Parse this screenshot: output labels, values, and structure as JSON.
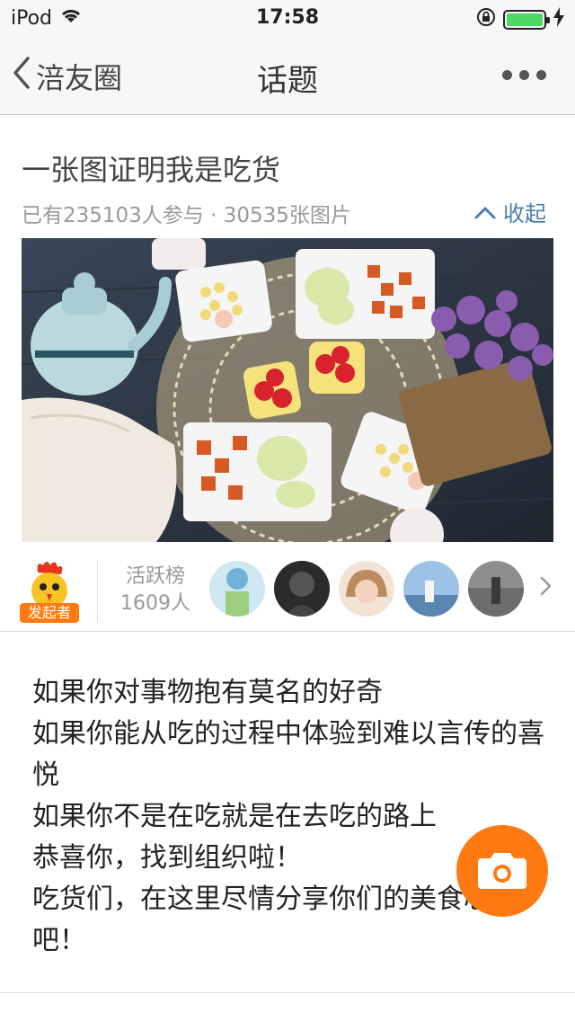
{
  "status_bar": {
    "carrier": "iPod",
    "time": "17:58",
    "battery_level": 1.0
  },
  "nav": {
    "back_label": "涪友圈",
    "title": "话题"
  },
  "topic": {
    "title": "一张图证明我是吃货",
    "stats": "已有235103人参与 · 30535张图片",
    "collapse_label": "收起"
  },
  "activity": {
    "initiator_badge": "发起者",
    "rank_title": "活跃榜",
    "rank_count": "1609人"
  },
  "description": {
    "lines": [
      "如果你对事物抱有莫名的好奇",
      "如果你能从吃的过程中体验到难以言传的喜悦",
      "如果你不是在吃就是在去吃的路上",
      "恭喜你，找到组织啦！",
      "吃货们，在这里尽情分享你们的美食心得吧！"
    ]
  },
  "colors": {
    "accent_orange": "#ff7a12",
    "link_blue": "#4a7fb0",
    "battery_green": "#4cd964"
  },
  "icons": {
    "wifi": "wifi-icon",
    "lock_rotation": "rotation-lock-icon",
    "charging": "charging-bolt-icon",
    "back": "chevron-left-icon",
    "more": "more-dots-icon",
    "collapse": "chevron-up-icon",
    "next": "chevron-right-icon",
    "camera": "camera-icon"
  }
}
